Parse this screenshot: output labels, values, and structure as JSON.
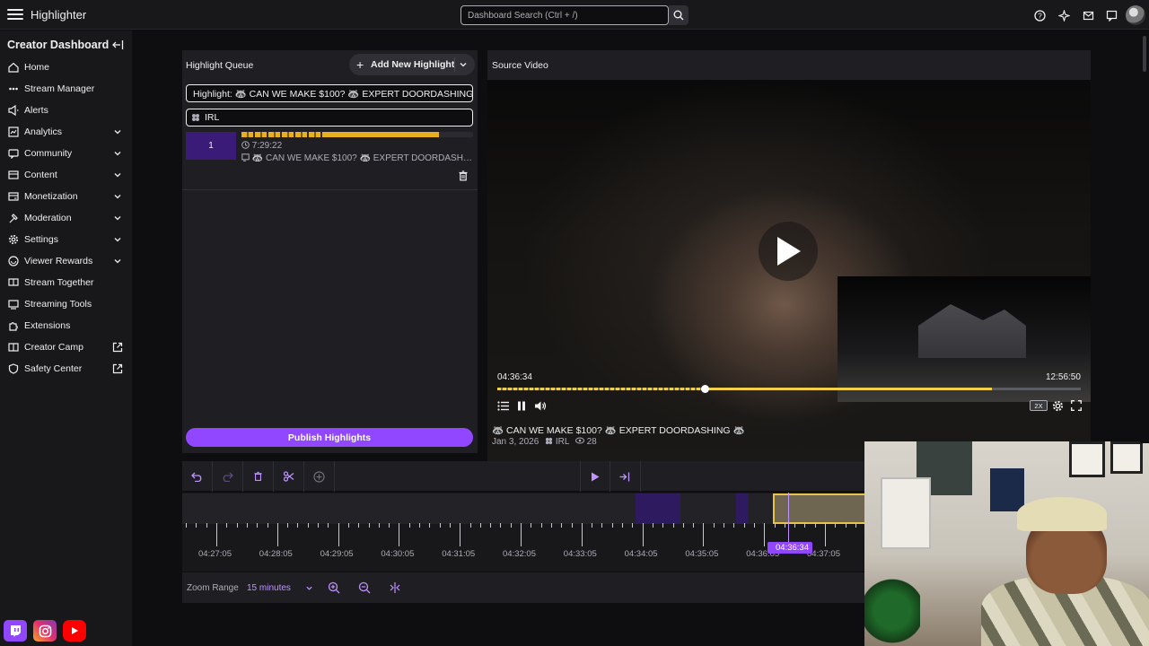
{
  "app": {
    "title": "Highlighter"
  },
  "search": {
    "placeholder": "Dashboard Search (Ctrl + /)"
  },
  "topbar_icons": [
    "help-icon",
    "sparkle-icon",
    "inbox-icon",
    "whispers-icon",
    "bits-icon",
    "avatar"
  ],
  "sidebar": {
    "title": "Creator Dashboard",
    "items": [
      {
        "label": "Home",
        "icon": "home-icon",
        "expandable": false
      },
      {
        "label": "Stream Manager",
        "icon": "stream-manager-icon",
        "expandable": false
      },
      {
        "label": "Alerts",
        "icon": "alerts-icon",
        "expandable": false
      },
      {
        "label": "Analytics",
        "icon": "analytics-icon",
        "expandable": true
      },
      {
        "label": "Community",
        "icon": "community-icon",
        "expandable": true
      },
      {
        "label": "Content",
        "icon": "content-icon",
        "expandable": true
      },
      {
        "label": "Monetization",
        "icon": "monetization-icon",
        "expandable": true
      },
      {
        "label": "Moderation",
        "icon": "moderation-icon",
        "expandable": true
      },
      {
        "label": "Settings",
        "icon": "settings-icon",
        "expandable": true
      },
      {
        "label": "Viewer Rewards",
        "icon": "viewer-rewards-icon",
        "expandable": true
      },
      {
        "label": "Stream Together",
        "icon": "stream-together-icon",
        "expandable": false
      },
      {
        "label": "Streaming Tools",
        "icon": "streaming-tools-icon",
        "expandable": false
      },
      {
        "label": "Extensions",
        "icon": "extensions-icon",
        "expandable": false
      },
      {
        "label": "Creator Camp",
        "icon": "creator-camp-icon",
        "external": true
      },
      {
        "label": "Safety Center",
        "icon": "safety-center-icon",
        "external": true
      }
    ]
  },
  "queue": {
    "title": "Highlight Queue",
    "add_label": "Add New Highlight",
    "title_field": "Highlight: 🦝 CAN WE MAKE $100? 🦝 EXPERT DOORDASHING 🦝",
    "category_field": "IRL",
    "clip": {
      "number": "1",
      "duration": "7:29:22",
      "title": "🦝 CAN WE MAKE $100? 🦝 EXPERT DOORDASHIN..."
    },
    "publish_label": "Publish Highlights"
  },
  "video": {
    "panel_title": "Source Video",
    "current_time": "04:36:34",
    "total_time": "12:56:50",
    "progress": 0.356,
    "speed": "2X",
    "meta_title": "🦝 CAN WE MAKE $100? 🦝 EXPERT DOORDASHING 🦝",
    "meta_date": "Jan 3, 2026",
    "meta_category": "IRL",
    "meta_views": "28"
  },
  "timeline": {
    "tick_labels": [
      "04:27:05",
      "04:28:05",
      "04:29:05",
      "04:30:05",
      "04:31:05",
      "04:32:05",
      "04:33:05",
      "04:34:05",
      "04:35:05",
      "04:36:05",
      "04:37:05"
    ],
    "playhead": "04:36:34"
  },
  "zoom": {
    "label": "Zoom Range",
    "value": "15 minutes"
  },
  "colors": {
    "accent": "#9147ff",
    "highlight_gold": "#e8b020",
    "background": "#0e0e10",
    "panel": "#1f1f23"
  }
}
